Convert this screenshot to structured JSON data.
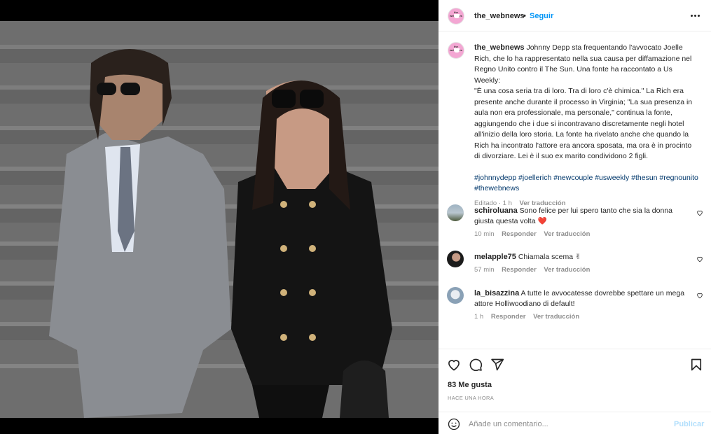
{
  "post": {
    "username": "the_webnews",
    "dot": "•",
    "follow_label": "Seguir",
    "avatar_text": "the webnews"
  },
  "caption": {
    "username": "the_webnews",
    "text_1": "Johnny Depp sta frequentando l'avvocato Joelle Rich, che lo ha rappresentato nella sua causa per diffamazione nel Regno Unito contro il The Sun. Una fonte ha raccontato a Us Weekly:",
    "text_2": "\"È una cosa seria tra di loro. Tra di loro c'è chimica.\" La Rich era presente anche durante il processo in Virginia; \"La sua presenza in aula non era professionale, ma personale,\" continua la fonte, aggiungendo che i due si incontravano discretamente negli hotel all'inizio della loro storia. La fonte ha rivelato anche che quando la Rich ha incontrato l'attore era ancora sposata, ma ora è in procinto di divorziare. Lei è il suo ex marito condividono 2 figli.",
    "hashtags": "#johnnydepp #joellerich #newcouple #usweekly #thesun #regnounito #thewebnews",
    "edited": "Editado · 1 h",
    "translate": "Ver traducción"
  },
  "comments": [
    {
      "username": "schiroluana",
      "text": "Sono felice per lui spero tanto che sia la donna giusta questa volta ❤️",
      "time": "10 min",
      "reply": "Responder",
      "translate": "Ver traducción"
    },
    {
      "username": "melapple75",
      "text": "Chiamala scema ✌",
      "time": "57 min",
      "reply": "Responder",
      "translate": "Ver traducción"
    },
    {
      "username": "la_bisazzina",
      "text": "A tutte le avvocatesse dovrebbe spettare un mega attore Holliwoodiano di default!",
      "time": "1 h",
      "reply": "Responder",
      "translate": "Ver traducción"
    }
  ],
  "actions": {
    "likes": "83 Me gusta",
    "time": "HACE UNA HORA",
    "heart_icon": "heart-icon",
    "comment_icon": "comment-icon",
    "share_icon": "paper-plane-icon",
    "save_icon": "bookmark-icon"
  },
  "add_comment": {
    "placeholder": "Añade un comentario...",
    "publish": "Publicar"
  },
  "colors": {
    "link": "#0095f6",
    "hashtag": "#00376b",
    "muted": "#8e8e8e",
    "publish_disabled": "#b2dffc",
    "heart_red": "#ed4956"
  }
}
